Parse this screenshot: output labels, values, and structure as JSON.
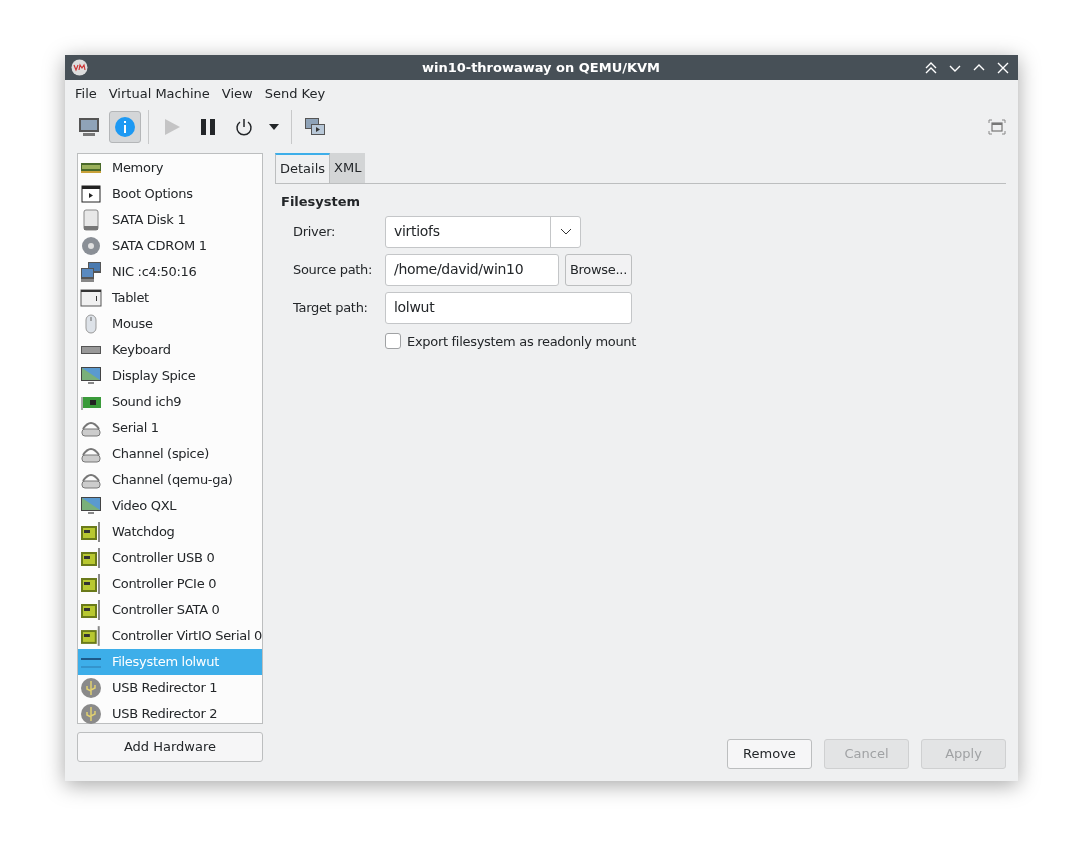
{
  "window": {
    "title": "win10-throwaway on QEMU/KVM"
  },
  "menu": [
    "File",
    "Virtual Machine",
    "View",
    "Send Key"
  ],
  "toolbar": [
    {
      "kind": "console",
      "selected": false,
      "disabled": false
    },
    {
      "kind": "details",
      "selected": true,
      "disabled": false
    },
    {
      "kind": "run",
      "selected": false,
      "disabled": true
    },
    {
      "kind": "pause",
      "selected": false,
      "disabled": false
    },
    {
      "kind": "power",
      "selected": false,
      "disabled": false
    },
    {
      "kind": "dropdown",
      "selected": false,
      "disabled": false
    },
    {
      "kind": "snapshots",
      "selected": false,
      "disabled": false
    }
  ],
  "hardware": [
    {
      "label": "Memory",
      "kind": "memory",
      "selected": false
    },
    {
      "label": "Boot Options",
      "kind": "boot",
      "selected": false
    },
    {
      "label": "SATA Disk 1",
      "kind": "disk",
      "selected": false
    },
    {
      "label": "SATA CDROM 1",
      "kind": "cdrom",
      "selected": false
    },
    {
      "label": "NIC :c4:50:16",
      "kind": "nic",
      "selected": false
    },
    {
      "label": "Tablet",
      "kind": "tablet",
      "selected": false
    },
    {
      "label": "Mouse",
      "kind": "mouse",
      "selected": false
    },
    {
      "label": "Keyboard",
      "kind": "keyboard",
      "selected": false
    },
    {
      "label": "Display Spice",
      "kind": "display",
      "selected": false
    },
    {
      "label": "Sound ich9",
      "kind": "sound",
      "selected": false
    },
    {
      "label": "Serial 1",
      "kind": "serial",
      "selected": false
    },
    {
      "label": "Channel (spice)",
      "kind": "serial",
      "selected": false
    },
    {
      "label": "Channel (qemu-ga)",
      "kind": "serial",
      "selected": false
    },
    {
      "label": "Video QXL",
      "kind": "display",
      "selected": false
    },
    {
      "label": "Watchdog",
      "kind": "card",
      "selected": false
    },
    {
      "label": "Controller USB 0",
      "kind": "card",
      "selected": false
    },
    {
      "label": "Controller PCIe 0",
      "kind": "card",
      "selected": false
    },
    {
      "label": "Controller SATA 0",
      "kind": "card",
      "selected": false
    },
    {
      "label": "Controller VirtIO Serial 0",
      "kind": "card",
      "selected": false
    },
    {
      "label": "Filesystem lolwut",
      "kind": "filesystem",
      "selected": true
    },
    {
      "label": "USB Redirector 1",
      "kind": "usb",
      "selected": false
    },
    {
      "label": "USB Redirector 2",
      "kind": "usb",
      "selected": false
    }
  ],
  "add_hardware": "Add Hardware",
  "tabs": [
    {
      "label": "Details",
      "selected": true
    },
    {
      "label": "XML",
      "selected": false
    }
  ],
  "section_title": "Filesystem",
  "driver": {
    "label": "Driver:",
    "value": "virtiofs"
  },
  "source_path": {
    "label": "Source path:",
    "value": "/home/david/win10",
    "button": "Browse..."
  },
  "target_path": {
    "label": "Target path:",
    "value": "lolwut"
  },
  "readonly": {
    "label": "Export filesystem as readonly mount",
    "checked": false
  },
  "buttons": [
    {
      "label": "Remove",
      "disabled": false
    },
    {
      "label": "Cancel",
      "disabled": true
    },
    {
      "label": "Apply",
      "disabled": true
    }
  ]
}
